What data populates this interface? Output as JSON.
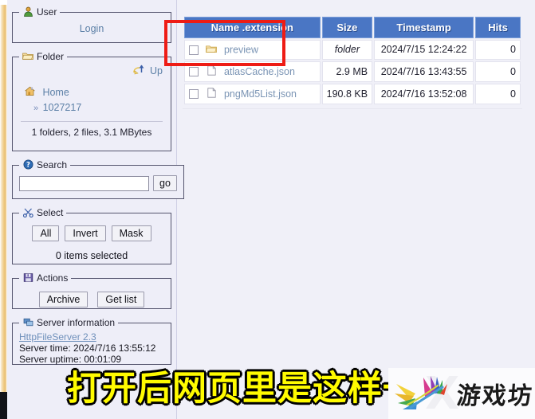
{
  "app": {
    "background_color": "#f0f0f8",
    "header_color": "#4a76c4",
    "link_color": "#5b7fa6",
    "annotation_color": "#ee1c15"
  },
  "sidebar": {
    "user": {
      "legend": "User",
      "icon": "user-icon",
      "login_label": "Login"
    },
    "folder": {
      "legend": "Folder",
      "icon": "folder-icon",
      "up_label": "Up",
      "up_icon": "arrow-up-icon",
      "home_label": "Home",
      "home_icon": "home-icon",
      "breadcrumb_arrow": "»",
      "breadcrumb_label": "1027217",
      "stats": "1 folders, 2 files, 3.1 MBytes"
    },
    "search": {
      "legend": "Search",
      "icon": "help-icon",
      "value": "",
      "placeholder": "",
      "go_label": "go"
    },
    "select": {
      "legend": "Select",
      "icon": "scissors-icon",
      "buttons": [
        {
          "label": "All",
          "name": "select-all-button"
        },
        {
          "label": "Invert",
          "name": "select-invert-button"
        },
        {
          "label": "Mask",
          "name": "select-mask-button"
        }
      ],
      "status": "0 items selected"
    },
    "actions": {
      "legend": "Actions",
      "icon": "save-icon",
      "buttons": [
        {
          "label": "Archive",
          "name": "archive-button"
        },
        {
          "label": "Get list",
          "name": "get-list-button"
        }
      ]
    },
    "server": {
      "legend": "Server information",
      "icon": "server-icon",
      "product_link": "HttpFileServer 2.3",
      "time_line": "Server time: 2024/7/16 13:55:12",
      "uptime_line": "Server uptime: 00:01:09"
    }
  },
  "file_table": {
    "columns": [
      {
        "label": "Name .extension",
        "name": "column-header-name"
      },
      {
        "label": "Size",
        "name": "column-header-size"
      },
      {
        "label": "Timestamp",
        "name": "column-header-timestamp"
      },
      {
        "label": "Hits",
        "name": "column-header-hits"
      }
    ],
    "rows": [
      {
        "icon": "folder-icon",
        "name": "preview",
        "size": "folder",
        "is_folder": true,
        "timestamp": "2024/7/15 12:24:22",
        "hits": "0"
      },
      {
        "icon": "file-icon",
        "name": "atlasCache.json",
        "size": "2.9 MB",
        "is_folder": false,
        "timestamp": "2024/7/16 13:43:55",
        "hits": "0"
      },
      {
        "icon": "file-icon",
        "name": "pngMd5List.json",
        "size": "190.8 KB",
        "is_folder": false,
        "timestamp": "2024/7/16 13:52:08",
        "hits": "0"
      }
    ]
  },
  "overlay": {
    "caption": "打开后网页里是这样一",
    "caption_fill": "#fffb00",
    "caption_stroke": "#000000",
    "watermark_text": "游戏坊",
    "watermark_ghost": "X"
  }
}
